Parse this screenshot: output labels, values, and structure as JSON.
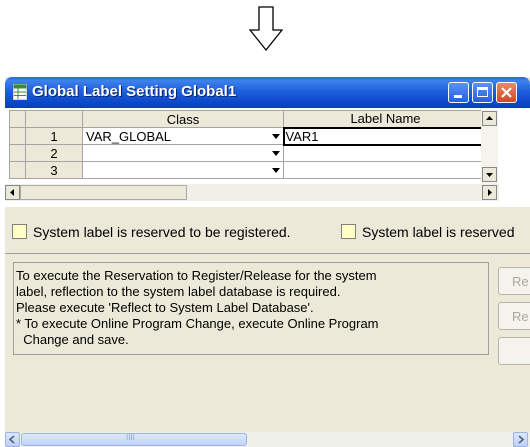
{
  "window": {
    "title": "Global Label Setting Global1"
  },
  "grid": {
    "columns": [
      "Class",
      "Label Name"
    ],
    "rows": [
      {
        "num": "1",
        "class": "VAR_GLOBAL",
        "label": "VAR1"
      },
      {
        "num": "2",
        "class": "",
        "label": ""
      },
      {
        "num": "3",
        "class": "",
        "label": ""
      }
    ]
  },
  "legend": [
    {
      "text": "System label is reserved to be registered."
    },
    {
      "text": "System label is reserved"
    }
  ],
  "message": "To execute the Reservation to Register/Release for the system\nlabel, reflection to the system label database is required.\nPlease execute 'Reflect to System Label Database'.\n* To execute Online Program Change, execute Online Program\n  Change and save.",
  "side_buttons": [
    "Re",
    "Re",
    ""
  ],
  "scrollbar": {
    "thumb_grip": "IIII"
  },
  "colors": {
    "titlebar": "#0a47c8",
    "legend_square": "#ffffc6",
    "window_bg": "#ece9d8"
  }
}
